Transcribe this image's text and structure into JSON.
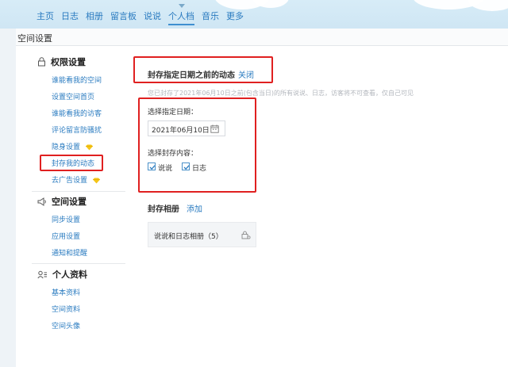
{
  "nav": {
    "items": [
      "主页",
      "日志",
      "相册",
      "留言板",
      "说说",
      "个人档",
      "音乐",
      "更多"
    ],
    "active_index": 5
  },
  "page": {
    "title": "空间设置"
  },
  "sidebar": {
    "groups": [
      {
        "title": "权限设置",
        "icon": "lock-icon",
        "items": [
          "谁能看我的空间",
          "设置空间首页",
          "谁能看我的访客",
          "评论留言防骚扰",
          "隐身设置",
          "封存我的动态",
          "去广告设置"
        ]
      },
      {
        "title": "空间设置",
        "icon": "megaphone-icon",
        "items": [
          "同步设置",
          "应用设置",
          "通知和提醒"
        ]
      },
      {
        "title": "个人资料",
        "icon": "person-card-icon",
        "items": [
          "基本资料",
          "空间资料",
          "空间头像"
        ]
      }
    ]
  },
  "main": {
    "archive_title": "封存指定日期之前的动态",
    "close_label": "关闭",
    "archive_desc": "您已封存了2021年06月10日之前(包含当日)的所有说说、日志，访客将不可查看，仅自己可见",
    "select_date_label": "选择指定日期：",
    "date_value": "2021年06月10日",
    "select_content_label": "选择封存内容：",
    "options": [
      {
        "label": "说说",
        "checked": true
      },
      {
        "label": "日志",
        "checked": true
      }
    ],
    "album_title": "封存相册",
    "add_label": "添加",
    "album_item": "说说和日志相册（5）"
  },
  "colors": {
    "link": "#2a7bc0",
    "highlight": "#e02020",
    "vip_diamond": "#f5c518"
  }
}
